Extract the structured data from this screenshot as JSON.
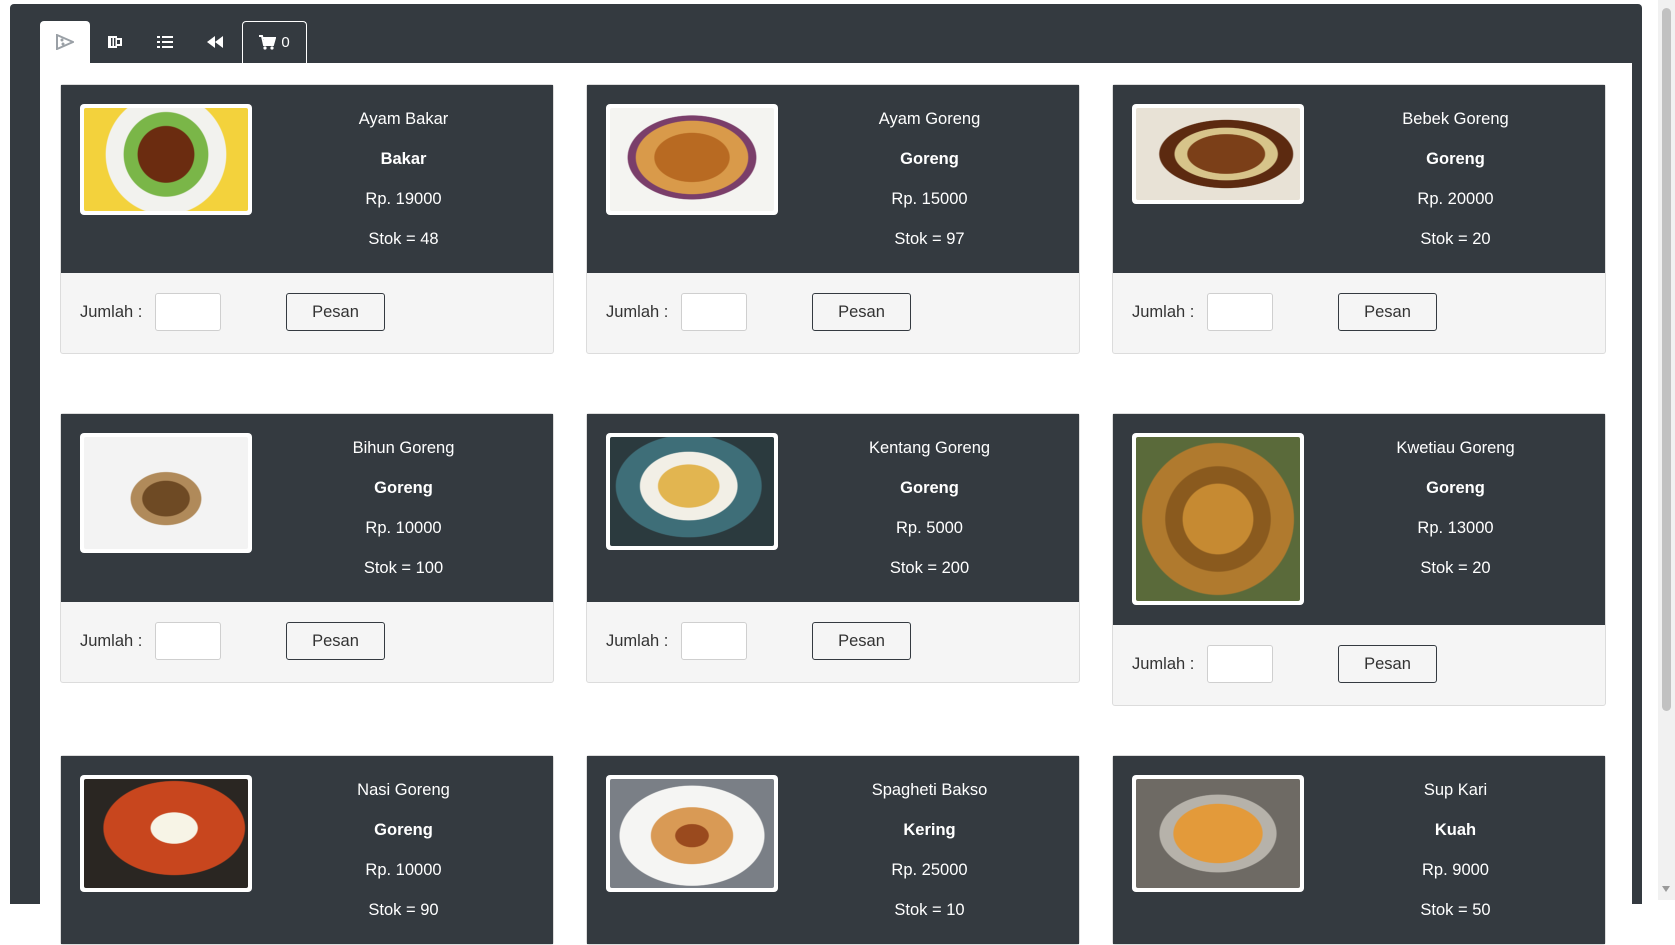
{
  "nav": {
    "tabs": [
      {
        "icon": "pizza-icon",
        "active": true
      },
      {
        "icon": "mug-icon",
        "active": false
      },
      {
        "icon": "list-icon",
        "active": false
      },
      {
        "icon": "backward-icon",
        "active": false
      }
    ],
    "cart": {
      "icon": "cart-icon",
      "count": "0"
    }
  },
  "labels": {
    "qty": "Jumlah :",
    "order": "Pesan"
  },
  "menu": [
    {
      "name": "Ayam Bakar",
      "category": "Bakar",
      "price": "Rp. 19000",
      "stock": "Stok = 48",
      "image": "grilled-chicken-photo",
      "tone": "#7a3b1a"
    },
    {
      "name": "Ayam Goreng",
      "category": "Goreng",
      "price": "Rp. 15000",
      "stock": "Stok = 97",
      "image": "fried-chicken-photo",
      "tone": "#c07a33"
    },
    {
      "name": "Bebek Goreng",
      "category": "Goreng",
      "price": "Rp. 20000",
      "stock": "Stok = 20",
      "image": "fried-duck-photo",
      "tone": "#8a5a2a"
    },
    {
      "name": "Bihun Goreng",
      "category": "Goreng",
      "price": "Rp. 10000",
      "stock": "Stok = 100",
      "image": "fried-vermicelli-photo",
      "tone": "#a0794a"
    },
    {
      "name": "Kentang Goreng",
      "category": "Goreng",
      "price": "Rp. 5000",
      "stock": "Stok = 200",
      "image": "french-fries-photo",
      "tone": "#d9a441"
    },
    {
      "name": "Kwetiau Goreng",
      "category": "Goreng",
      "price": "Rp. 13000",
      "stock": "Stok = 20",
      "image": "fried-flat-noodles-photo",
      "tone": "#b5782a"
    },
    {
      "name": "Nasi Goreng",
      "category": "Goreng",
      "price": "Rp. 10000",
      "stock": "Stok = 90",
      "image": "fried-rice-photo",
      "tone": "#c04a22"
    },
    {
      "name": "Spagheti Bakso",
      "category": "Kering",
      "price": "Rp. 25000",
      "stock": "Stok = 10",
      "image": "spaghetti-meatball-photo",
      "tone": "#b55a2a"
    },
    {
      "name": "Sup Kari",
      "category": "Kuah",
      "price": "Rp. 9000",
      "stock": "Stok = 50",
      "image": "curry-soup-photo",
      "tone": "#d98a2a"
    }
  ]
}
